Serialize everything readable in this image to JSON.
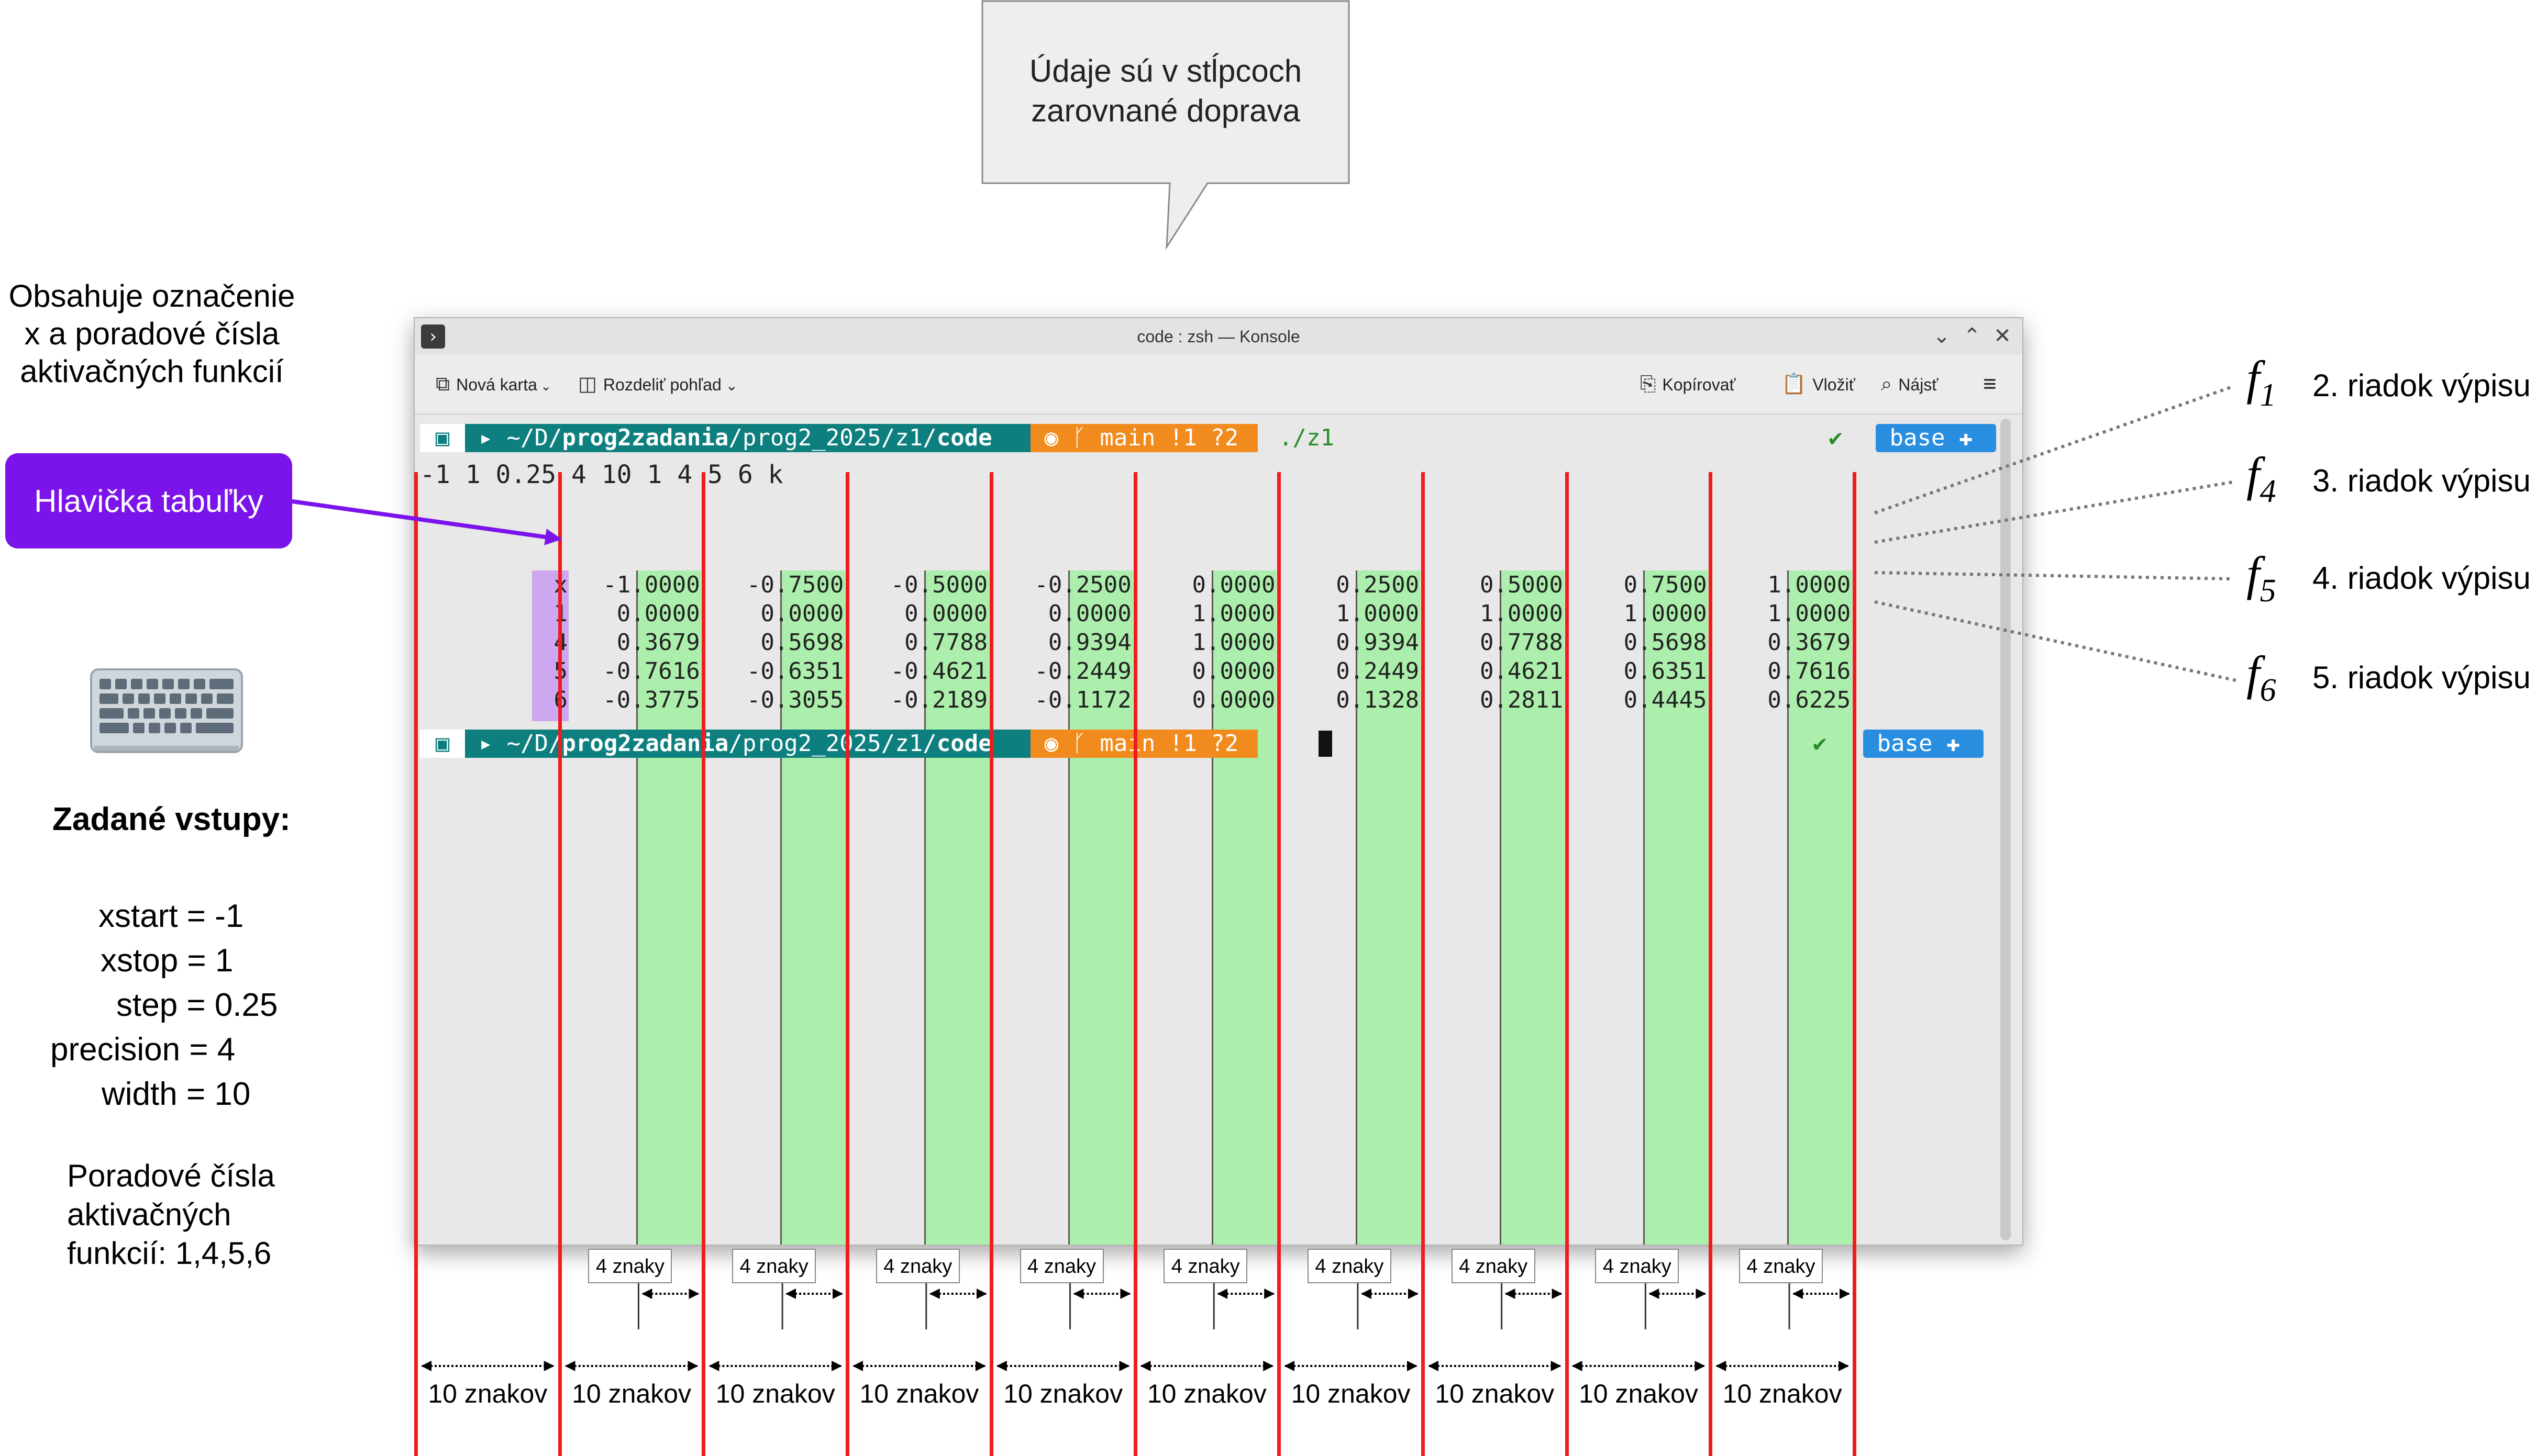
{
  "callout": {
    "text": "Údaje sú v stĺpcoch zarovnané doprava"
  },
  "left": {
    "description": "Obsahuje označenie x a poradové čísla aktivačných funkcií",
    "header_label": "Hlavička tabuľky",
    "keyboard_icon": "keyboard-icon",
    "inputs_title": "Zadané vstupy:",
    "inputs": [
      "xstart = -1",
      "xstop = 1",
      "step = 0.25",
      "precision = 4",
      "width = 10"
    ],
    "activation_label": "Poradové čísla aktivačných funkcií: 1,4,5,6"
  },
  "right": {
    "items": [
      {
        "symbol": "f",
        "sub": "1",
        "desc": "2. riadok výpisu"
      },
      {
        "symbol": "f",
        "sub": "4",
        "desc": "3. riadok výpisu"
      },
      {
        "symbol": "f",
        "sub": "5",
        "desc": "4. riadok výpisu"
      },
      {
        "symbol": "f",
        "sub": "6",
        "desc": "5. riadok výpisu"
      }
    ]
  },
  "window": {
    "title": "code : zsh — Konsole",
    "controls": [
      "chevron-down-icon",
      "chevron-up-icon",
      "close-icon"
    ],
    "toolbar": {
      "new_tab": "Nová karta",
      "split_view": "Rozdeliť pohľad",
      "copy": "Kopírovať",
      "paste": "Vložiť",
      "find": "Nájsť"
    }
  },
  "terminal": {
    "prompt": {
      "path_prefix": "~/D/",
      "path_bold1": "prog2zadania",
      "path_mid": "/prog2_2025/z1/",
      "path_bold2": "code",
      "git": "main !1 ?2",
      "command": "./z1",
      "check": "✔",
      "env": "base"
    },
    "input_line": "-1 1 0.25 4 10 1 4 5 6 k",
    "table": {
      "header_label": "x",
      "header": [
        "-1.0000",
        "-0.7500",
        "-0.5000",
        "-0.2500",
        "0.0000",
        "0.2500",
        "0.5000",
        "0.7500",
        "1.0000"
      ],
      "rows": [
        {
          "label": "1",
          "values": [
            "0.0000",
            "0.0000",
            "0.0000",
            "0.0000",
            "1.0000",
            "1.0000",
            "1.0000",
            "1.0000",
            "1.0000"
          ]
        },
        {
          "label": "4",
          "values": [
            "0.3679",
            "0.5698",
            "0.7788",
            "0.9394",
            "1.0000",
            "0.9394",
            "0.7788",
            "0.5698",
            "0.3679"
          ]
        },
        {
          "label": "5",
          "values": [
            "-0.7616",
            "-0.6351",
            "-0.4621",
            "-0.2449",
            "0.0000",
            "0.2449",
            "0.4621",
            "0.6351",
            "0.7616"
          ]
        },
        {
          "label": "6",
          "values": [
            "-0.3775",
            "-0.3055",
            "-0.2189",
            "-0.1172",
            "0.0000",
            "0.1328",
            "0.2811",
            "0.4445",
            "0.6225"
          ]
        }
      ]
    }
  },
  "bottom": {
    "znaky_label": "4 znaky",
    "znakov_label": "10 znakov"
  },
  "colors": {
    "purple": "#7b14ea",
    "red": "#ee1c1c",
    "green": "#a9efa9",
    "teal": "#0e7f7f",
    "orange": "#f28b1e",
    "blue": "#2a8ee0"
  }
}
